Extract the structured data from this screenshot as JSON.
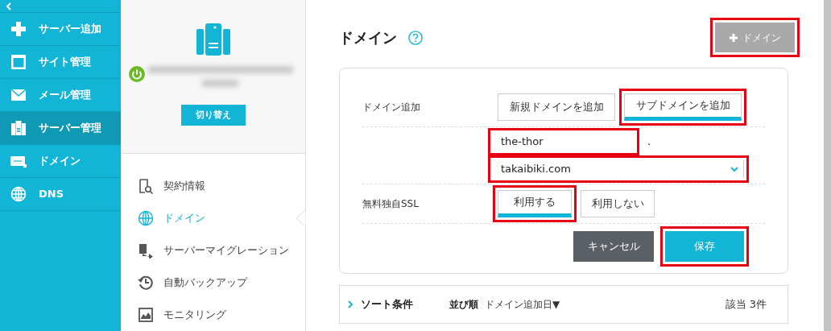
{
  "sidebar": {
    "items": [
      {
        "label": "サーバー追加",
        "selected": false
      },
      {
        "label": "サイト管理",
        "selected": false
      },
      {
        "label": "メール管理",
        "selected": false
      },
      {
        "label": "サーバー管理",
        "selected": true
      },
      {
        "label": "ドメイン",
        "selected": false
      },
      {
        "label": "DNS",
        "selected": false
      }
    ]
  },
  "server_panel": {
    "switch_button": "切り替え",
    "menu": [
      {
        "label": "契約情報",
        "selected": false
      },
      {
        "label": "ドメイン",
        "selected": true
      },
      {
        "label": "サーバーマイグレーション",
        "selected": false
      },
      {
        "label": "自動バックアップ",
        "selected": false
      },
      {
        "label": "モニタリング",
        "selected": false
      }
    ]
  },
  "page": {
    "title": "ドメイン",
    "add_button": {
      "label": "ドメイン",
      "highlighted": true
    }
  },
  "form": {
    "domain_add": {
      "label": "ドメイン追加",
      "options": [
        {
          "label": "新規ドメインを追加",
          "selected": false,
          "highlighted": false
        },
        {
          "label": "サブドメインを追加",
          "selected": true,
          "highlighted": true
        }
      ]
    },
    "subdomain": {
      "value": "the-thor",
      "highlighted": true,
      "separator": "."
    },
    "domain_select": {
      "value": "takaibiki.com",
      "highlighted": true
    },
    "ssl": {
      "label": "無料独自SSL",
      "options": [
        {
          "label": "利用する",
          "selected": true,
          "highlighted": true
        },
        {
          "label": "利用しない",
          "selected": false,
          "highlighted": false
        }
      ]
    },
    "cancel_button": {
      "label": "キャンセル"
    },
    "save_button": {
      "label": "保存",
      "highlighted": true
    }
  },
  "sort_bar": {
    "title": "ソート条件",
    "order_label": "並び順",
    "order_value": "ドメイン追加日▼",
    "count": "該当 3件"
  }
}
